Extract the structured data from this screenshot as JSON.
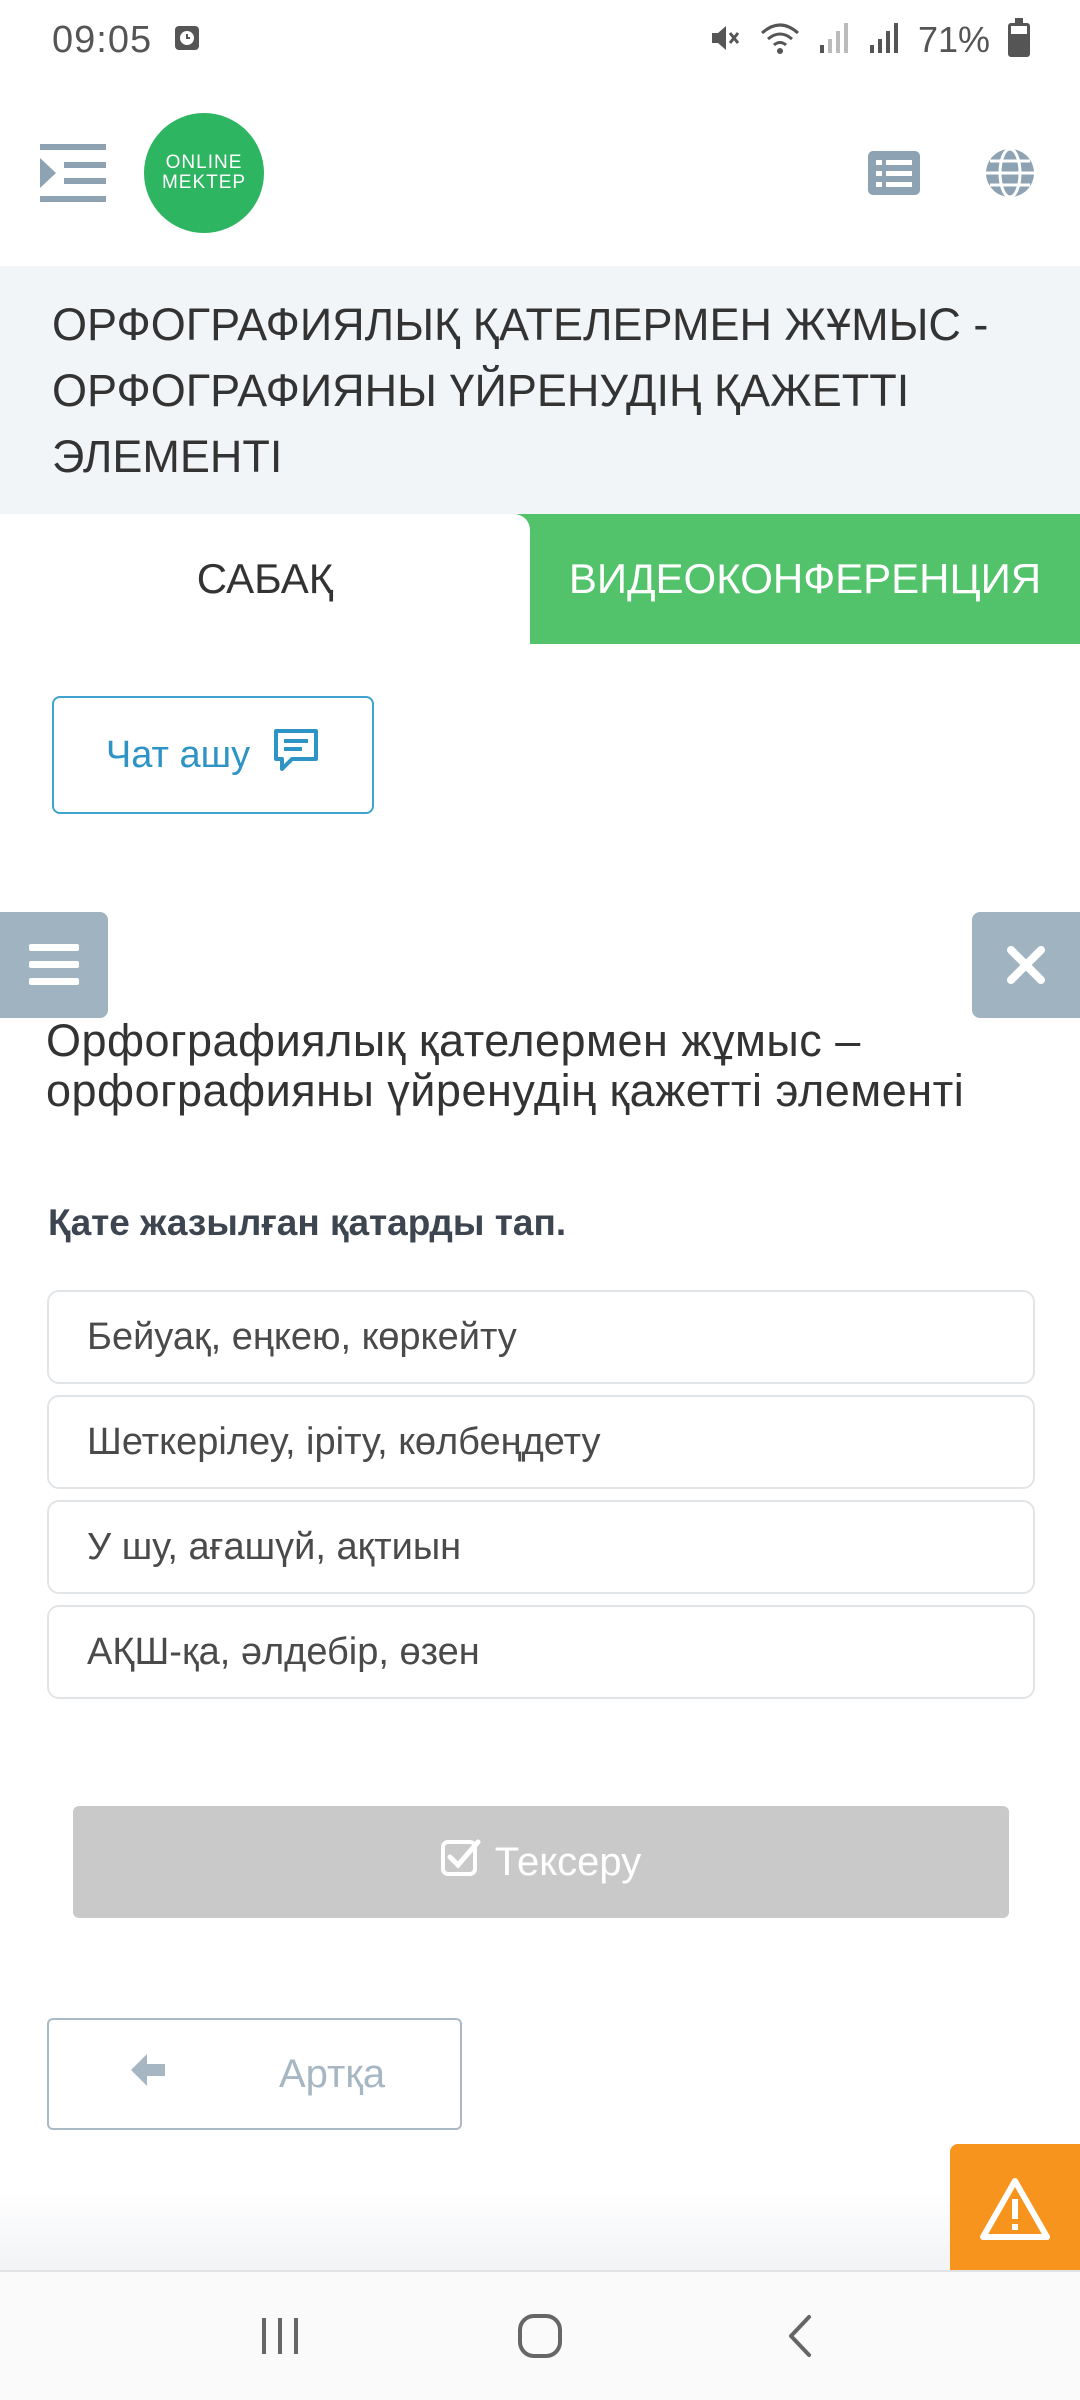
{
  "status_bar": {
    "time": "09:05",
    "battery": "71%"
  },
  "header": {
    "logo_line1": "ONLINE",
    "logo_line2": "MEKTEP",
    "icons": [
      "menu-indent-icon",
      "list-icon",
      "globe-icon"
    ]
  },
  "lesson": {
    "title": "ОРФОГРАФИЯЛЫҚ ҚАТЕЛЕРМЕН ЖҰМЫС - ОРФОГРАФИЯНЫ ҮЙРЕНУДІҢ ҚАЖЕТТІ ЭЛЕМЕНТІ"
  },
  "tabs": {
    "lesson": "САБАҚ",
    "video": "ВИДЕОКОНФЕРЕНЦИЯ"
  },
  "chat": {
    "label": "Чат ашу"
  },
  "task": {
    "title": "Орфографиялық қателермен жұмыс – орфографияны үйренудің қажетті элементі",
    "question": "Қате жазылған қатарды тап.",
    "answers": [
      "Бейуақ, еңкею, көркейту",
      "Шеткерілеу, іріту, көлбеңдету",
      "У шу, ағашүй, ақтиын",
      "АҚШ-қа, әлдебір, өзен"
    ],
    "check_label": "Тексеру",
    "back_label": "Артқа"
  },
  "colors": {
    "green": "#52c26b",
    "logo_green": "#2db561",
    "chat_blue": "#2e94c6",
    "side_gray": "#9fb3c0",
    "warning_orange": "#f7941d"
  }
}
